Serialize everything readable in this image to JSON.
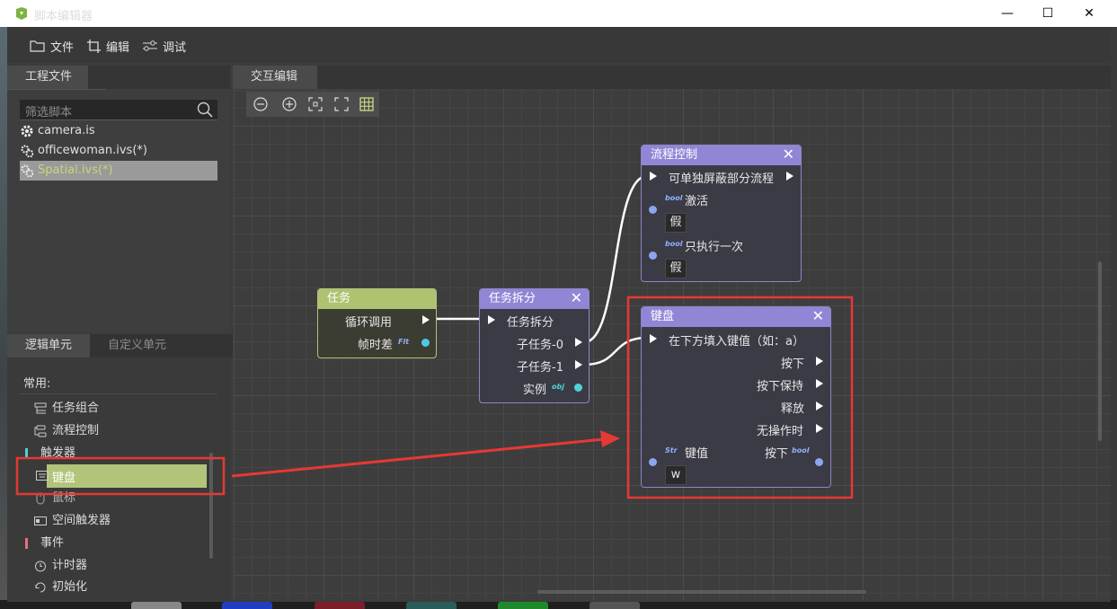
{
  "window": {
    "title": "脚本编辑器",
    "minimize": "—",
    "maximize": "☐",
    "close": "✕"
  },
  "menu": {
    "file": "文件",
    "edit": "编辑",
    "debug": "调试"
  },
  "project": {
    "tab": "工程文件",
    "filter_placeholder": "筛选脚本",
    "files": [
      "camera.is",
      "officewoman.ivs(*)",
      "Spatial.ivs(*)"
    ]
  },
  "logic": {
    "tab_logic": "逻辑单元",
    "tab_custom": "自定义单元",
    "common": "常用:",
    "items": {
      "task_group": "任务组合",
      "flow_control": "流程控制",
      "trigger": "触发器",
      "keyboard": "键盘",
      "mouse": "鼠标",
      "space_trigger": "空间触发器",
      "event": "事件",
      "timer": "计时器",
      "init": "初始化"
    }
  },
  "editor": {
    "tab": "交互编辑"
  },
  "colors": {
    "node_purple": "#9186d6",
    "node_green": "#afc270",
    "selection": "#b1c47a",
    "annotation": "#e53935"
  },
  "nodes": {
    "task": {
      "title": "任务",
      "loop_call": "循环调用",
      "frame_delta": "帧时差",
      "flt_tag": "Flt"
    },
    "split": {
      "title": "任务拆分",
      "input": "任务拆分",
      "sub0": "子任务-0",
      "sub1": "子任务-1",
      "instance": "实例",
      "obj_tag": "obj"
    },
    "flow": {
      "title": "流程控制",
      "input": "可单独屏蔽部分流程",
      "activate": "激活",
      "activate_val": "假",
      "once": "只执行一次",
      "once_val": "假",
      "bool_tag": "bool"
    },
    "keyboard": {
      "title": "键盘",
      "input": "在下方填入键值（如：a）",
      "press": "按下",
      "hold": "按下保持",
      "release": "释放",
      "idle": "无操作时",
      "key_label": "键值",
      "key_val": "w",
      "pressed_out": "按下",
      "str_tag": "Str",
      "bool_tag": "bool"
    }
  }
}
